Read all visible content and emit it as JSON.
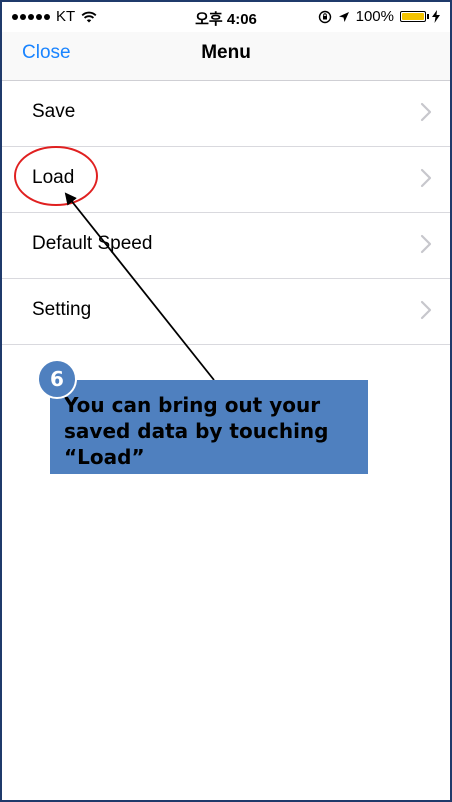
{
  "status_bar": {
    "carrier": "KT",
    "time": "오후 4:06",
    "battery": "100%",
    "battery_level": 1.0,
    "icons": [
      "signal-dots-icon",
      "wifi-icon",
      "rotation-lock-icon",
      "location-arrow-icon",
      "battery-icon",
      "charging-bolt-icon"
    ]
  },
  "nav": {
    "close_label": "Close",
    "title": "Menu"
  },
  "menu": {
    "items": [
      {
        "label": "Save"
      },
      {
        "label": "Load"
      },
      {
        "label": "Default Speed"
      },
      {
        "label": "Setting"
      }
    ]
  },
  "annotation": {
    "step_number": "6",
    "callout_text": "You can bring out your saved data by touching “Load”",
    "highlight_color": "#e02020",
    "callout_color": "#4f80bf"
  },
  "colors": {
    "accent": "#1a84ff"
  }
}
